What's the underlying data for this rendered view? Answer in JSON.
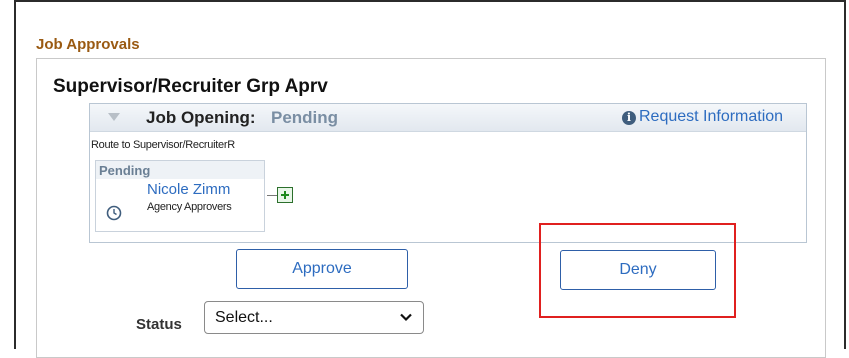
{
  "section": {
    "title": "Job Approvals"
  },
  "approval_group": {
    "title": "Supervisor/Recruiter Grp Aprv"
  },
  "stage": {
    "label": "Job Opening:",
    "status": "Pending",
    "request_info_link": "Request Information",
    "route_text": "Route to Supervisor/RecruiterR"
  },
  "approver": {
    "status": "Pending",
    "name": "Nicole Zimm",
    "role": "Agency Approvers"
  },
  "actions": {
    "approve_label": "Approve",
    "deny_label": "Deny"
  },
  "status_field": {
    "label": "Status",
    "selected": "Select..."
  },
  "colors": {
    "section_title": "#9a5a12",
    "link": "#2d6cc0",
    "pending_status": "#7a8ea3",
    "highlight": "#e0201f",
    "button_border": "#2e5fa8"
  },
  "icons": {
    "collapse": "triangle-down-icon",
    "info": "info-circle-icon",
    "clock": "clock-icon",
    "add": "plus-square-icon",
    "dropdown": "chevron-down-icon"
  }
}
